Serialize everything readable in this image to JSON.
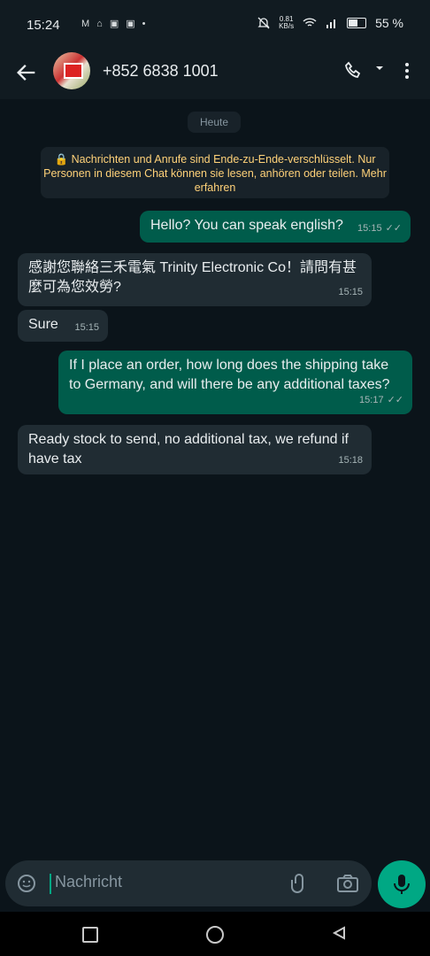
{
  "status_bar": {
    "time": "15:24",
    "network_speed_value": "0.81",
    "network_speed_unit": "KB/s",
    "battery": "55 %"
  },
  "header": {
    "contact": "+852 6838 1001"
  },
  "chat": {
    "date": "Heute",
    "encryption_notice": "Nachrichten und Anrufe sind Ende-zu-Ende-verschlüsselt. Nur Personen in diesem Chat können sie lesen, anhören oder teilen. Mehr erfahren",
    "messages": [
      {
        "direction": "out",
        "text": "Hello? You can speak english?",
        "time": "15:15",
        "read": true
      },
      {
        "direction": "in",
        "text": "感謝您聯絡三禾電氣 Trinity Electronic Co！請問有甚麼可為您效勞?",
        "time": "15:15"
      },
      {
        "direction": "in",
        "text": "Sure",
        "time": "15:15"
      },
      {
        "direction": "out",
        "text": "If I place an order, how long does the shipping take to Germany, and will there be any additional taxes?",
        "time": "15:17",
        "read": true
      },
      {
        "direction": "in",
        "text": "Ready stock to send, no additional tax, we refund if have tax",
        "time": "15:18"
      }
    ]
  },
  "composer": {
    "placeholder": "Nachricht"
  },
  "colors": {
    "accent": "#00a884",
    "outgoing": "#005c4b",
    "incoming": "#202c33",
    "notice_text": "#ffd279"
  },
  "icons": [
    "back-arrow-icon",
    "phone-icon",
    "caret-down-icon",
    "menu-icon",
    "lock-icon",
    "emoji-icon",
    "attach-icon",
    "camera-icon",
    "mic-icon",
    "double-check-icon"
  ]
}
